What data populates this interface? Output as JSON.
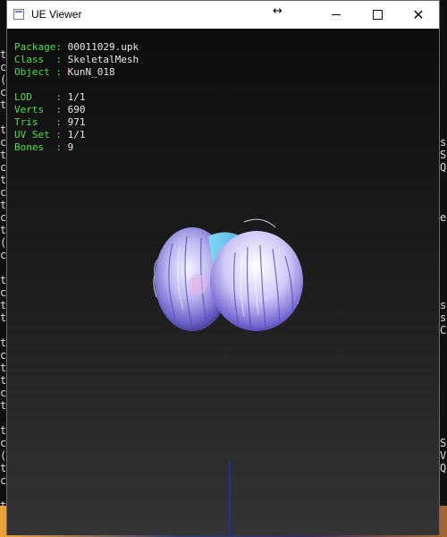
{
  "window": {
    "title": "UE Viewer",
    "resize_cursor_glyph": "↔",
    "minimize_icon": "minimize-icon",
    "maximize_icon": "maximize-icon",
    "close_icon": "close-icon",
    "close_glyph": "✕"
  },
  "info": {
    "package_label": "Package:",
    "package_value": "00011029.upk",
    "class_label": "Class  :",
    "class_value": "SkeletalMesh",
    "object_label": "Object :",
    "object_value": "KunN_018",
    "lod_label": "LOD    :",
    "lod_value": "1/1",
    "verts_label": "Verts  :",
    "verts_value": "690",
    "tris_label": "Tris   :",
    "tris_value": "971",
    "uvset_label": "UV Set :",
    "uvset_value": "1/1",
    "bones_label": "Bones  :",
    "bones_value": "9"
  },
  "background": {
    "left_console_chars": [
      "t",
      "c",
      "(",
      "c",
      "t",
      "",
      "t",
      "c",
      "t",
      "c",
      "t",
      "c",
      "t",
      "c",
      "t",
      "(",
      "c",
      "",
      "t",
      "c",
      "t",
      "t",
      "",
      "t",
      "c",
      "t",
      "t",
      "c",
      "t",
      "",
      "t",
      "c",
      "(",
      "t",
      "c",
      "",
      "t",
      "c",
      "t"
    ],
    "right_console_chars": [
      "",
      "",
      "",
      "",
      "",
      "",
      "",
      "s",
      "S",
      "Q",
      "",
      "",
      "",
      "e",
      "",
      "",
      "",
      "",
      "",
      "",
      "s",
      "s",
      "C",
      "",
      "",
      "",
      "",
      "",
      "",
      "",
      "",
      "S",
      "V",
      "Q",
      "",
      "",
      "",
      ""
    ],
    "colors": {
      "console_bg": "#101010",
      "info_key": "#4be04b",
      "info_value": "#e8e8e8",
      "axis": "#1f2fa8"
    }
  }
}
